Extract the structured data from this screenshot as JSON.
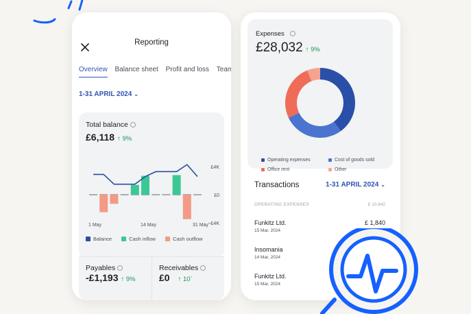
{
  "colors": {
    "accent": "#2f53b5",
    "positive": "#21925b",
    "balance_line": "#2a4e9c",
    "cash_inflow": "#3cc896",
    "cash_outflow": "#f39a86",
    "donut_operating": "#2a4fa8",
    "donut_cogs": "#4a74cf",
    "donut_office_rent": "#ef6d58",
    "donut_other": "#f4a392",
    "deco_blue": "#1560ff"
  },
  "reporting": {
    "close_icon": "close-icon",
    "title": "Reporting",
    "tabs": [
      "Overview",
      "Balance sheet",
      "Profit and loss",
      "Team"
    ],
    "active_tab": "Overview",
    "date_range": "1-31 APRIL 2024",
    "balance": {
      "label": "Total balance",
      "value": "£6,118",
      "delta": "↑ 9%"
    },
    "payables": {
      "label": "Payables",
      "value": "-£1,193",
      "delta": "↑ 9%"
    },
    "receivables": {
      "label": "Receivables",
      "value": "£0",
      "delta": "↑ 10`"
    }
  },
  "chart_data": {
    "type": "bar",
    "title": "",
    "xlabel": "",
    "ylabel": "",
    "x_tick_labels": [
      "1 May",
      "14 May",
      "31 May"
    ],
    "y_tick_labels": [
      "£4K",
      "£0",
      "−£4K"
    ],
    "ylim": [
      -4,
      4
    ],
    "categories": [
      "1",
      "2",
      "3",
      "4",
      "5",
      "6",
      "7",
      "8",
      "9",
      "10",
      "11"
    ],
    "series": [
      {
        "name": "Balance",
        "kind": "line",
        "values": [
          2.9,
          2.9,
          1.5,
          1.5,
          1.5,
          2.6,
          3.3,
          3.3,
          3.3,
          4.3,
          2.6
        ]
      },
      {
        "name": "Cash inflow",
        "kind": "bar",
        "values": [
          0,
          0,
          0,
          0,
          1.4,
          2.7,
          0,
          0,
          2.8,
          0,
          0
        ]
      },
      {
        "name": "Cash outflow",
        "kind": "bar",
        "values": [
          0,
          -2.5,
          -1.3,
          0,
          0,
          0,
          0,
          0,
          0,
          -3.5,
          0
        ]
      }
    ],
    "grid": false,
    "legend_position": "bottom"
  },
  "expenses": {
    "label": "Expenses",
    "value": "£28,032",
    "delta": "↑ 9%",
    "slices": [
      {
        "name": "Operating expenses",
        "value": 40
      },
      {
        "name": "Cost of goods sold",
        "value": 28
      },
      {
        "name": "Office rent",
        "value": 26
      },
      {
        "name": "Other",
        "value": 6
      }
    ]
  },
  "transactions": {
    "heading": "Transactions",
    "date_range": "1-31 APRIL 2024",
    "category": "OPERATING EXPENSES",
    "category_total": "£ 10,642",
    "rows": [
      {
        "name": "Funkitz Ltd.",
        "date": "15 Mar, 2024",
        "amount": "£ 1,840"
      },
      {
        "name": "Insomania",
        "date": "14 Mar, 2024",
        "amount": ""
      },
      {
        "name": "Funkitz Ltd.",
        "date": "15 Mar, 2024",
        "amount": ""
      }
    ]
  },
  "decoration": {
    "badge_icon": "pulse-chat-icon"
  }
}
